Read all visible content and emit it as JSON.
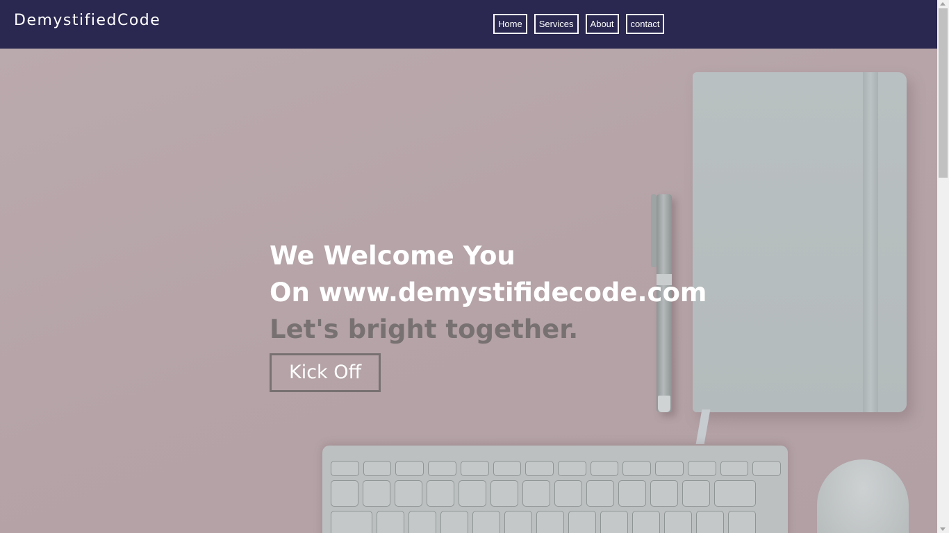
{
  "navbar": {
    "brand": "DemystifiedCode",
    "links": [
      {
        "label": "Home"
      },
      {
        "label": "Services"
      },
      {
        "label": "About"
      },
      {
        "label": "contact"
      }
    ]
  },
  "hero": {
    "headline_line1": "We Welcome You",
    "headline_line2": "On www.demystifidecode.com",
    "tagline": "Let's bright together.",
    "cta_label": "Kick Off"
  },
  "colors": {
    "navbar_bg": "#2a2850",
    "hero_bg": "#b6a4a8",
    "headline": "#ffffff",
    "tagline": "#787172",
    "cta_border": "#787172"
  },
  "icons": {
    "scroll_up": "scroll-up-arrow-icon",
    "scroll_down": "scroll-down-arrow-icon"
  }
}
